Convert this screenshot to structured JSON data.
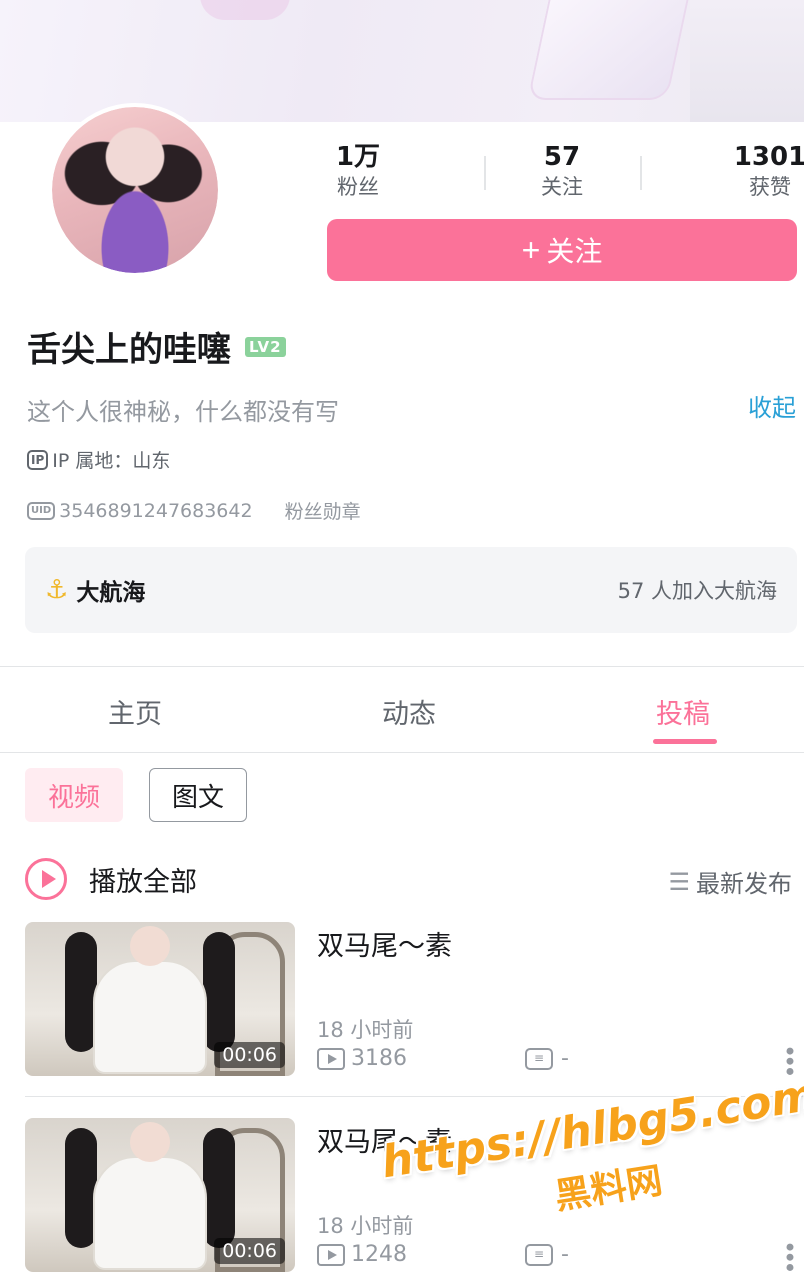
{
  "profile": {
    "name": "舌尖上的哇噻",
    "level": "LV2",
    "sign": "这个人很神秘，什么都没有写",
    "collapse_label": "收起",
    "ip_label": "IP 属地：山东",
    "ip_icon_text": "IP",
    "uid_icon_text": "UID",
    "uid": "3546891247683642",
    "fan_badge_label": "粉丝勋章"
  },
  "stats": {
    "fans": {
      "value": "1万",
      "label": "粉丝"
    },
    "following": {
      "value": "57",
      "label": "关注"
    },
    "likes": {
      "value": "1301",
      "label": "获赞"
    }
  },
  "follow_button": {
    "plus": "+",
    "label": "关注"
  },
  "fleet": {
    "icon": "anchor-icon",
    "title": "大航海",
    "summary": "57 人加入大航海"
  },
  "tabs": [
    {
      "label": "主页",
      "active": false
    },
    {
      "label": "动态",
      "active": false
    },
    {
      "label": "投稿",
      "active": true
    }
  ],
  "filters": [
    {
      "label": "视频",
      "active": true
    },
    {
      "label": "图文",
      "active": false
    }
  ],
  "play_all": {
    "label": "播放全部"
  },
  "sort": {
    "icon": "☰",
    "label": "最新发布"
  },
  "videos": [
    {
      "title": "双马尾～素",
      "duration": "00:06",
      "time": "18 小时前",
      "plays": "3186",
      "danmu": "-"
    },
    {
      "title": "双马尾～素",
      "duration": "00:06",
      "time": "18 小时前",
      "plays": "1248",
      "danmu": "-"
    }
  ],
  "watermark": {
    "url": "https://hlbg5.com",
    "name": "黑料网"
  },
  "colors": {
    "accent": "#fb7299",
    "link": "#2aa0d6",
    "level_badge": "#8bd29b",
    "watermark": "#f7a21b"
  }
}
